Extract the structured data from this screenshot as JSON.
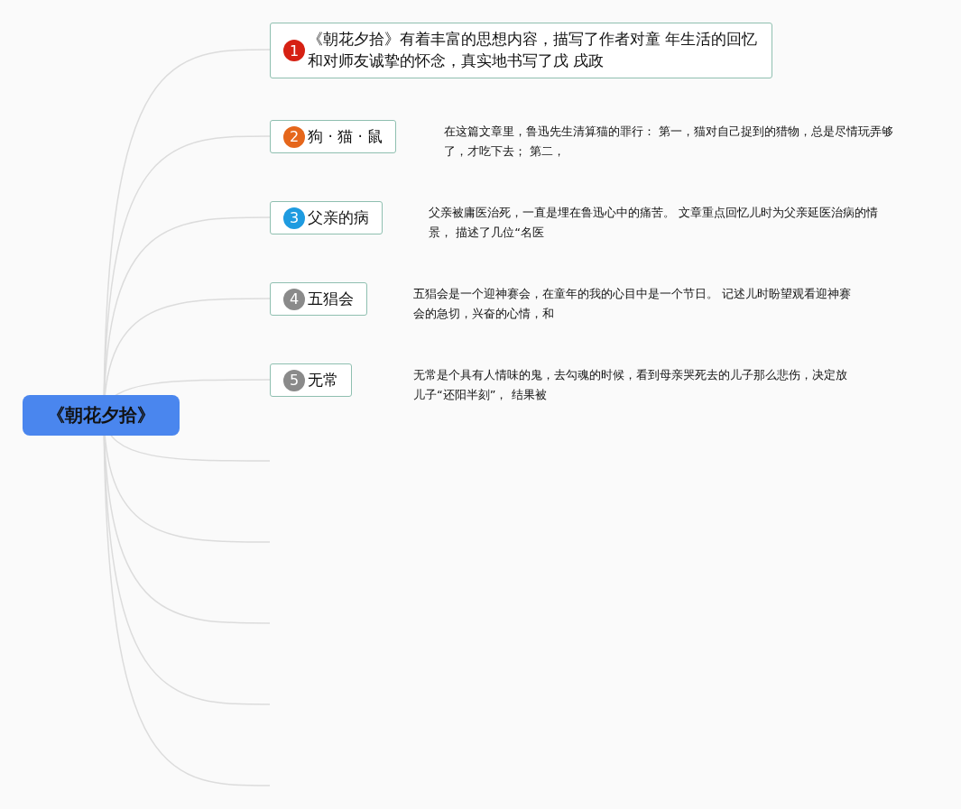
{
  "root": {
    "title": "《朝花夕拾》"
  },
  "topics": [
    {
      "number": "1",
      "color": "#d62113",
      "title": "《朝花夕拾》有着丰富的思想内容，描写了作者对童 年生活的回忆和对师友诚挚的怀念，真实地书写了戊 戌政"
    },
    {
      "number": "2",
      "color": "#e5661b",
      "title": "狗 · 猫 · 鼠",
      "note": "在这篇文章里，鲁迅先生清算猫的罪行： 第一，猫对自己捉到的猎物，总是尽情玩弄够了，才吃下去； 第二，"
    },
    {
      "number": "3",
      "color": "#1e9be0",
      "title": "父亲的病",
      "note": "父亲被庸医治死，一直是埋在鲁迅心中的痛苦。 文章重点回忆儿时为父亲延医治病的情景， 描述了几位“名医"
    },
    {
      "number": "4",
      "color": "#8a8a8a",
      "title": "五猖会",
      "note": "五猖会是一个迎神赛会，在童年的我的心目中是一个节日。 记述儿时盼望观看迎神赛会的急切，兴奋的心情，和"
    },
    {
      "number": "5",
      "color": "#8a8a8a",
      "title": "无常",
      "note": "无常是个具有人情味的鬼，去勾魂的时候，看到母亲哭死去的儿子那么悲伤，决定放儿子“还阳半刻”， 结果被"
    }
  ]
}
